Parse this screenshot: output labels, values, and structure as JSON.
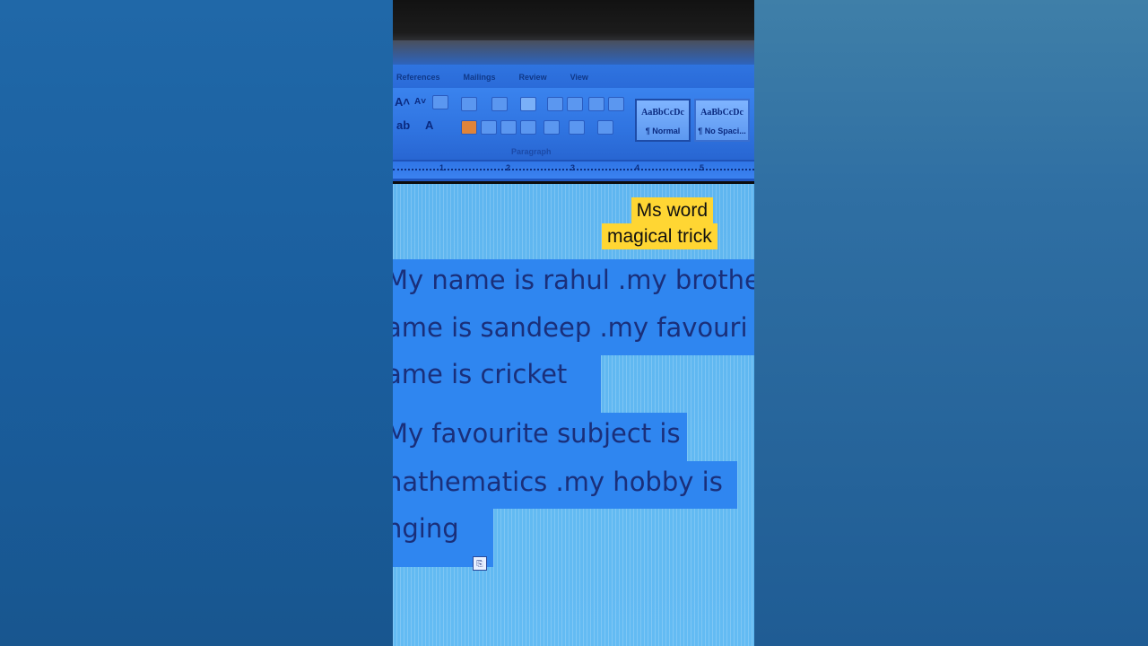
{
  "ribbon": {
    "tabs": [
      "References",
      "Mailings",
      "Review",
      "View"
    ],
    "group_paragraph_label": "Paragraph",
    "styles": [
      {
        "preview": "AaBbCcDc",
        "name": "¶ Normal"
      },
      {
        "preview": "AaBbCcDc",
        "name": "¶ No Spaci..."
      }
    ]
  },
  "ruler": {
    "numbers": [
      "1",
      "2",
      "3",
      "4",
      "5"
    ]
  },
  "document": {
    "lines": [
      "My name is rahul .my brothe",
      "ame is sandeep .my favouri",
      "ame is cricket",
      "My favourite subject is",
      "nathematics .my hobby is",
      "nging"
    ]
  },
  "overlay": {
    "line1": "Ms word",
    "line2": "magical trick"
  },
  "colors": {
    "selection": "#2f86f0",
    "caption_bg": "#ffd633",
    "text": "#1a2f7a"
  }
}
